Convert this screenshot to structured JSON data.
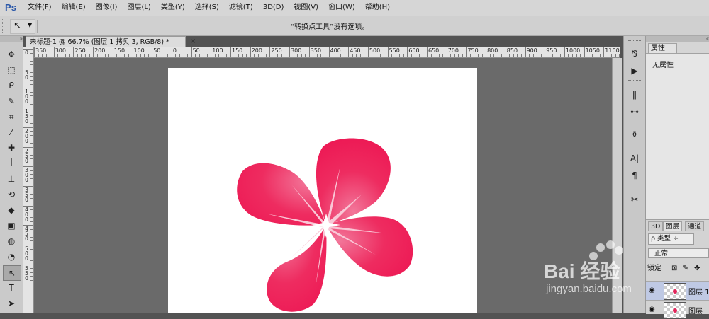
{
  "app": {
    "logo": "Ps"
  },
  "menu": [
    "文件(F)",
    "编辑(E)",
    "图像(I)",
    "图层(L)",
    "类型(Y)",
    "选择(S)",
    "滤镜(T)",
    "3D(D)",
    "视图(V)",
    "窗口(W)",
    "帮助(H)"
  ],
  "options_bar": {
    "tool_icon": "convert-point-tool-icon",
    "message": "“转换点工具”没有选项。"
  },
  "document": {
    "tab_title": "未标题-1 @ 66.7% (图层 1 拷贝 3, RGB/8) *",
    "close_glyph": "×",
    "background": "#ffffff",
    "canvas_bg": "#6a6a6a"
  },
  "ruler": {
    "top_labels": [
      "350",
      "300",
      "250",
      "200",
      "150",
      "100",
      "50",
      "0",
      "50",
      "100",
      "150",
      "200",
      "250",
      "300",
      "350",
      "400",
      "450",
      "500",
      "550",
      "600",
      "650",
      "700",
      "750",
      "800",
      "850",
      "900",
      "950",
      "1000",
      "1050",
      "1100"
    ],
    "left_labels": [
      "0",
      "5 0",
      "1 0 0",
      "1 5 0",
      "2 0 0",
      "2 5 0",
      "3 0 0",
      "3 5 0",
      "4 0 0",
      "4 5 0",
      "5 0 0",
      "5 5 0"
    ]
  },
  "tools": [
    {
      "name": "move-tool-icon",
      "glyph": "✥"
    },
    {
      "name": "marquee-tool-icon",
      "glyph": "⬚"
    },
    {
      "name": "lasso-tool-icon",
      "glyph": "ᑭ"
    },
    {
      "name": "quick-selection-tool-icon",
      "glyph": "✎"
    },
    {
      "name": "crop-tool-icon",
      "glyph": "⌗"
    },
    {
      "name": "eyedropper-tool-icon",
      "glyph": "⁄"
    },
    {
      "name": "healing-brush-tool-icon",
      "glyph": "✚"
    },
    {
      "name": "brush-tool-icon",
      "glyph": "ꟾ"
    },
    {
      "name": "clone-stamp-tool-icon",
      "glyph": "⊥"
    },
    {
      "name": "history-brush-tool-icon",
      "glyph": "⟲"
    },
    {
      "name": "eraser-tool-icon",
      "glyph": "◆"
    },
    {
      "name": "gradient-tool-icon",
      "glyph": "▣"
    },
    {
      "name": "blur-tool-icon",
      "glyph": "◍"
    },
    {
      "name": "dodge-tool-icon",
      "glyph": "◔"
    },
    {
      "name": "pen-tool-icon",
      "glyph": "↖",
      "active": true
    },
    {
      "name": "type-tool-icon",
      "glyph": "T"
    },
    {
      "name": "path-selection-tool-icon",
      "glyph": "➤"
    }
  ],
  "dock": [
    {
      "name": "history-panel-icon",
      "glyph": "⅋"
    },
    {
      "name": "actions-panel-icon",
      "glyph": "▶"
    },
    {
      "name": "brush-presets-icon",
      "glyph": "ǁ"
    },
    {
      "name": "adjustments-icon",
      "glyph": "⊷"
    },
    {
      "name": "clone-source-icon",
      "glyph": "⚱"
    },
    {
      "name": "character-panel-icon",
      "glyph": "A|"
    },
    {
      "name": "paragraph-panel-icon",
      "glyph": "¶"
    },
    {
      "name": "tool-presets-icon",
      "glyph": "✂"
    }
  ],
  "properties": {
    "tab": "属性",
    "value": "无属性"
  },
  "layers": {
    "tabs": [
      "3D",
      "图层",
      "通道"
    ],
    "filter_label": "ρ 类型 ÷",
    "blend_mode": "正常",
    "lock_label": "锁定",
    "rows": [
      {
        "name": "图层 1",
        "selected": true
      },
      {
        "name": "图层",
        "selected": false
      }
    ]
  },
  "watermark": {
    "text": "Bai 经验",
    "url": "jingyan.baidu.com"
  },
  "colors": {
    "petal_outer": "#ee1d58",
    "petal_inner": "#f26a8f",
    "vein": "#f9c7d6"
  }
}
